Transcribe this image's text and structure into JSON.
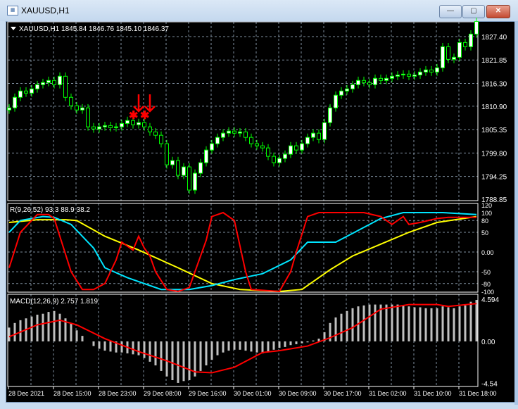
{
  "window": {
    "title": "XAUUSD,H1",
    "min_label": "—",
    "max_label": "▢",
    "close_label": "✕"
  },
  "price_panel": {
    "header": "XAUUSD,H1  1845.84 1846.76 1845.10 1846.37",
    "price_ticks": [
      "1827.40",
      "1821.85",
      "1816.30",
      "1810.90",
      "1805.35",
      "1799.80",
      "1794.25",
      "1788.85"
    ]
  },
  "rsi_panel": {
    "header": "R(9,26,52) 93.3 88.9 38.2",
    "ticks": [
      "120",
      "100",
      "80",
      "50",
      "0.00",
      "-50",
      "-80",
      "-100"
    ]
  },
  "macd_panel": {
    "header": "MACD(12,26,9) 2.757 1.819",
    "ticks": [
      "4.594",
      "0.00",
      "-4.54"
    ]
  },
  "time_labels": [
    "28 Dec 2021",
    "28 Dec 15:00",
    "28 Dec 23:00",
    "29 Dec 08:00",
    "29 Dec 16:00",
    "30 Dec 01:00",
    "30 Dec 09:00",
    "30 Dec 17:00",
    "31 Dec 02:00",
    "31 Dec 10:00",
    "31 Dec 18:00"
  ],
  "colors": {
    "candle": "#00ff00",
    "rsi_fast": "#ff0000",
    "rsi_mid": "#00e5ff",
    "rsi_slow": "#ffff00",
    "macd_hist": "#c0c0c0",
    "macd_signal": "#ff0000",
    "grid": "#8090a0"
  },
  "chart_data": {
    "type": "candlestick",
    "closes": [
      1810.5,
      1813,
      1814.5,
      1814,
      1815,
      1816,
      1816.5,
      1817,
      1816,
      1818,
      1813,
      1811,
      1810,
      1810.5,
      1806,
      1805.5,
      1806,
      1806.3,
      1805.8,
      1806,
      1806.8,
      1807.5,
      1806.5,
      1807,
      1806,
      1804.8,
      1804,
      1802,
      1797,
      1798,
      1794.5,
      1796.5,
      1791,
      1795,
      1797.5,
      1800.5,
      1802,
      1803.5,
      1804.5,
      1805,
      1804.5,
      1804.8,
      1803.5,
      1802,
      1801.5,
      1801,
      1799,
      1797.5,
      1798.5,
      1799.5,
      1801.5,
      1800.5,
      1802,
      1803.5,
      1804.5,
      1803,
      1807,
      1810.5,
      1813.5,
      1814.5,
      1815,
      1816,
      1817,
      1816.5,
      1816,
      1817.5,
      1817,
      1817.5,
      1818,
      1818.3,
      1818.5,
      1818,
      1818.3,
      1819,
      1819.5,
      1819,
      1820,
      1825,
      1822,
      1822.5,
      1826,
      1825,
      1828,
      1831
    ],
    "signals": [
      {
        "bar": 22,
        "type": "star"
      },
      {
        "bar": 24,
        "type": "star"
      },
      {
        "bar": 23,
        "type": "arrow-down"
      },
      {
        "bar": 25,
        "type": "arrow-down"
      }
    ],
    "rsi_fast": [
      [
        0,
        -40
      ],
      [
        2,
        50
      ],
      [
        5,
        95
      ],
      [
        7,
        95
      ],
      [
        8,
        85
      ],
      [
        11,
        -50
      ],
      [
        13,
        -95
      ],
      [
        15,
        -95
      ],
      [
        17,
        -80
      ],
      [
        19,
        -20
      ],
      [
        20,
        25
      ],
      [
        22,
        5
      ],
      [
        23,
        40
      ],
      [
        24,
        10
      ],
      [
        25,
        -10
      ],
      [
        26,
        -50
      ],
      [
        28,
        -95
      ],
      [
        30,
        -100
      ],
      [
        32,
        -90
      ],
      [
        33,
        -50
      ],
      [
        35,
        30
      ],
      [
        36,
        90
      ],
      [
        38,
        100
      ],
      [
        40,
        80
      ],
      [
        42,
        -50
      ],
      [
        43,
        -95
      ],
      [
        48,
        -100
      ],
      [
        50,
        -50
      ],
      [
        51,
        0
      ],
      [
        53,
        90
      ],
      [
        55,
        100
      ],
      [
        58,
        100
      ],
      [
        63,
        100
      ],
      [
        66,
        90
      ],
      [
        68,
        70
      ],
      [
        70,
        90
      ],
      [
        71,
        70
      ],
      [
        73,
        75
      ],
      [
        76,
        85
      ],
      [
        78,
        88
      ],
      [
        83,
        88
      ]
    ],
    "rsi_mid": [
      [
        0,
        50
      ],
      [
        2,
        80
      ],
      [
        6,
        90
      ],
      [
        8,
        88
      ],
      [
        11,
        70
      ],
      [
        15,
        10
      ],
      [
        17,
        -40
      ],
      [
        21,
        -65
      ],
      [
        27,
        -95
      ],
      [
        32,
        -95
      ],
      [
        36,
        -85
      ],
      [
        40,
        -70
      ],
      [
        45,
        -55
      ],
      [
        50,
        -20
      ],
      [
        52,
        10
      ],
      [
        53,
        25
      ],
      [
        58,
        25
      ],
      [
        62,
        55
      ],
      [
        66,
        85
      ],
      [
        70,
        100
      ],
      [
        77,
        100
      ],
      [
        83,
        95
      ]
    ],
    "rsi_slow": [
      [
        0,
        75
      ],
      [
        5,
        82
      ],
      [
        10,
        82
      ],
      [
        12,
        80
      ],
      [
        17,
        40
      ],
      [
        23,
        5
      ],
      [
        30,
        -40
      ],
      [
        36,
        -80
      ],
      [
        41,
        -95
      ],
      [
        48,
        -100
      ],
      [
        52,
        -95
      ],
      [
        57,
        -45
      ],
      [
        61,
        -10
      ],
      [
        66,
        20
      ],
      [
        71,
        50
      ],
      [
        76,
        75
      ],
      [
        83,
        90
      ]
    ],
    "macd_hist": [
      1.5,
      2,
      2.3,
      2.5,
      2.7,
      2.9,
      3,
      3.2,
      3.3,
      3,
      2.5,
      2,
      1.2,
      0.6,
      0,
      -0.5,
      -0.8,
      -1,
      -1.1,
      -1.2,
      -1.2,
      -1.3,
      -1.4,
      -1.5,
      -1.8,
      -2.2,
      -2.6,
      -3.2,
      -3.8,
      -4.2,
      -4.5,
      -4.3,
      -4.2,
      -3.8,
      -3.2,
      -2.6,
      -2,
      -1.5,
      -1.2,
      -1,
      -0.9,
      -0.9,
      -1,
      -1.1,
      -1.2,
      -1.3,
      -1.1,
      -0.9,
      -0.7,
      -0.6,
      -0.4,
      -0.3,
      -0.2,
      -0.1,
      0.1,
      0.3,
      1,
      2,
      2.6,
      3,
      3.3,
      3.6,
      3.8,
      3.9,
      4,
      4,
      4,
      4,
      4,
      4,
      3.9,
      3.8,
      3.7,
      3.7,
      3.6,
      3.6,
      3.6,
      3.8,
      3.7,
      3.6,
      3.8,
      3.9,
      4.3,
      4.5
    ],
    "macd_signal": [
      [
        0,
        0.5
      ],
      [
        5,
        1.8
      ],
      [
        9,
        2.3
      ],
      [
        12,
        1.8
      ],
      [
        17,
        0.3
      ],
      [
        23,
        -1.1
      ],
      [
        28,
        -2.1
      ],
      [
        33,
        -3.3
      ],
      [
        36,
        -3.4
      ],
      [
        40,
        -2.8
      ],
      [
        45,
        -1.2
      ],
      [
        48,
        -1
      ],
      [
        53,
        -0.5
      ],
      [
        57,
        0.4
      ],
      [
        61,
        1.5
      ],
      [
        66,
        3.5
      ],
      [
        71,
        4
      ],
      [
        76,
        4
      ],
      [
        78,
        3.8
      ],
      [
        83,
        4.1
      ]
    ],
    "price_range": [
      1788.85,
      1827.4
    ],
    "rsi_range": [
      -120,
      120
    ],
    "macd_range": [
      -4.54,
      4.594
    ]
  }
}
